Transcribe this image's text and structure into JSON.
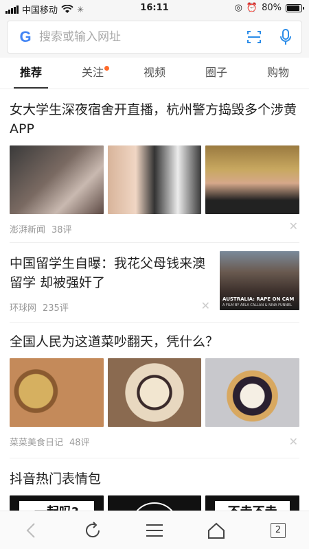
{
  "status_bar": {
    "carrier": "中国移动",
    "time": "16:11",
    "battery": "80%",
    "battery_level": 0.8
  },
  "search": {
    "logo": "G",
    "placeholder": "搜索或输入网址"
  },
  "tabs": [
    {
      "label": "推荐",
      "active": true
    },
    {
      "label": "关注",
      "has_dot": true
    },
    {
      "label": "视频"
    },
    {
      "label": "圈子"
    },
    {
      "label": "购物"
    }
  ],
  "articles": [
    {
      "title": "女大学生深夜宿舍开直播，杭州警方捣毁多个涉黄APP",
      "source": "澎湃新闻",
      "comments": "38评"
    },
    {
      "title": "中国留学生自曝：我花父母钱来澳留学 却被强奸了",
      "source": "环球网",
      "comments": "235评",
      "thumb_caption": "AUSTRALIA: RAPE ON CAM",
      "thumb_subcaption": "A FILM BY AELA CALLAN & NINA FUNNEL"
    },
    {
      "title": "全国人民为这道菜吵翻天，凭什么？",
      "source": "菜菜美食日记",
      "comments": "48评"
    },
    {
      "title": "抖音热门表情包",
      "thumb_texts": [
        "一起吗?",
        "不走不走"
      ]
    }
  ],
  "bottom_bar": {
    "tab_count": "2"
  },
  "colors": {
    "accent_dot": "#ff6a2a",
    "google_blue": "#4285F4",
    "icon_blue": "#2b8ce8"
  }
}
